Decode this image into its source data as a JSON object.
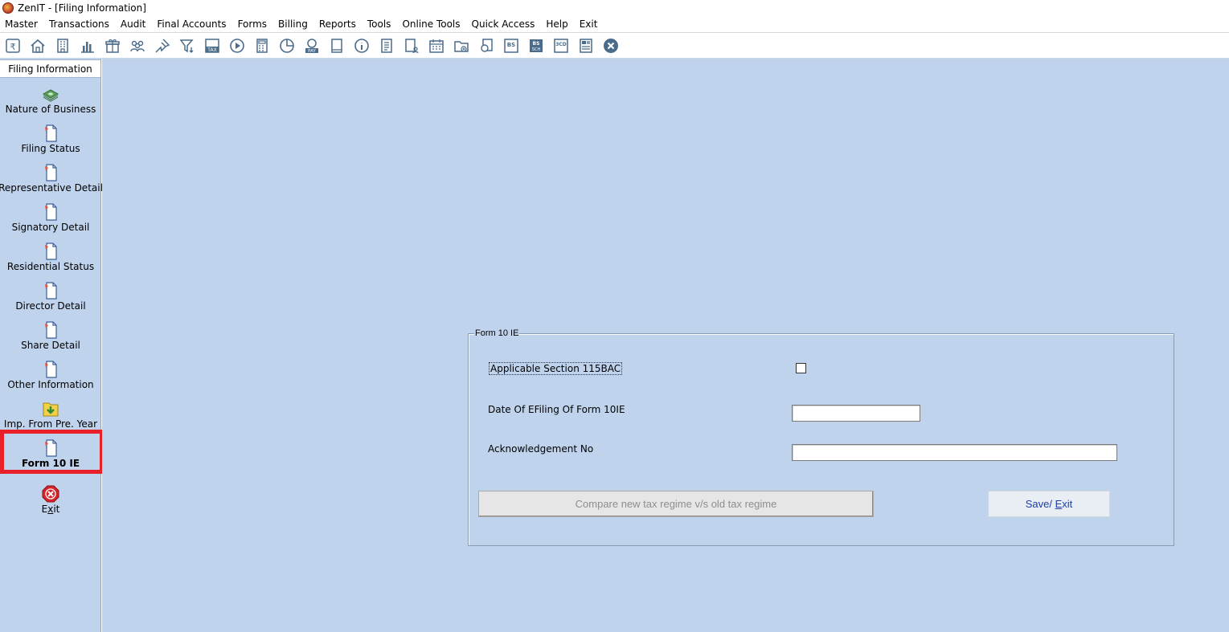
{
  "window": {
    "title": "ZenIT - [Filing Information]"
  },
  "menu": [
    "Master",
    "Transactions",
    "Audit",
    "Final Accounts",
    "Forms",
    "Billing",
    "Reports",
    "Tools",
    "Online Tools",
    "Quick Access",
    "Help",
    "Exit"
  ],
  "toolbar": {
    "icons": [
      "rupee-ledger-icon",
      "home-icon",
      "building-icon",
      "bar-chart-icon",
      "gift-icon",
      "users-icon",
      "pin-icon",
      "filter-icon",
      "tax-icon",
      "play-circle-icon",
      "calculator-icon",
      "pie-icon",
      "pay-icon",
      "book-icon",
      "info-icon",
      "report-icon",
      "document-user-icon",
      "calendar-icon",
      "folder-add-icon",
      "copy-document-icon",
      "bs-icon",
      "bs-sch-icon",
      "3cd-icon",
      "form-icon",
      "close-icon"
    ],
    "badge_tax": "TAX",
    "badge_pay": "PAY",
    "badge_bs": "BS",
    "badge_sch": "SCH",
    "badge_3cd": "3CD"
  },
  "sidebar": {
    "header": "Filing Information",
    "items": [
      {
        "label": "Nature of Business",
        "icon": "money-stack-icon"
      },
      {
        "label": "Filing Status",
        "icon": "document-icon"
      },
      {
        "label": "Representative Detail",
        "icon": "document-icon"
      },
      {
        "label": "Signatory Detail",
        "icon": "document-icon"
      },
      {
        "label": "Residential Status",
        "icon": "document-icon"
      },
      {
        "label": "Director Detail",
        "icon": "document-icon"
      },
      {
        "label": "Share Detail",
        "icon": "document-icon"
      },
      {
        "label": "Other Information",
        "icon": "document-icon"
      },
      {
        "label": "Imp. From Pre. Year",
        "icon": "import-folder-icon"
      },
      {
        "label": "Form 10 IE",
        "icon": "document-icon",
        "active": true
      },
      {
        "label": "Exit",
        "icon": "exit-icon"
      }
    ]
  },
  "form": {
    "group_title": "Form 10 IE",
    "section_115bac_label": "Applicable Section 115BAC",
    "section_115bac_checked": false,
    "date_label": "Date Of EFiling Of Form 10IE",
    "date_value": "",
    "ack_label": "Acknowledgement No",
    "ack_value": "",
    "compare_button": "Compare new tax regime v/s old tax regime",
    "save_button": "Save/ Exit"
  },
  "colors": {
    "background": "#bfd3ec",
    "highlight": "#e8202a",
    "link_blue": "#1a3da8"
  }
}
